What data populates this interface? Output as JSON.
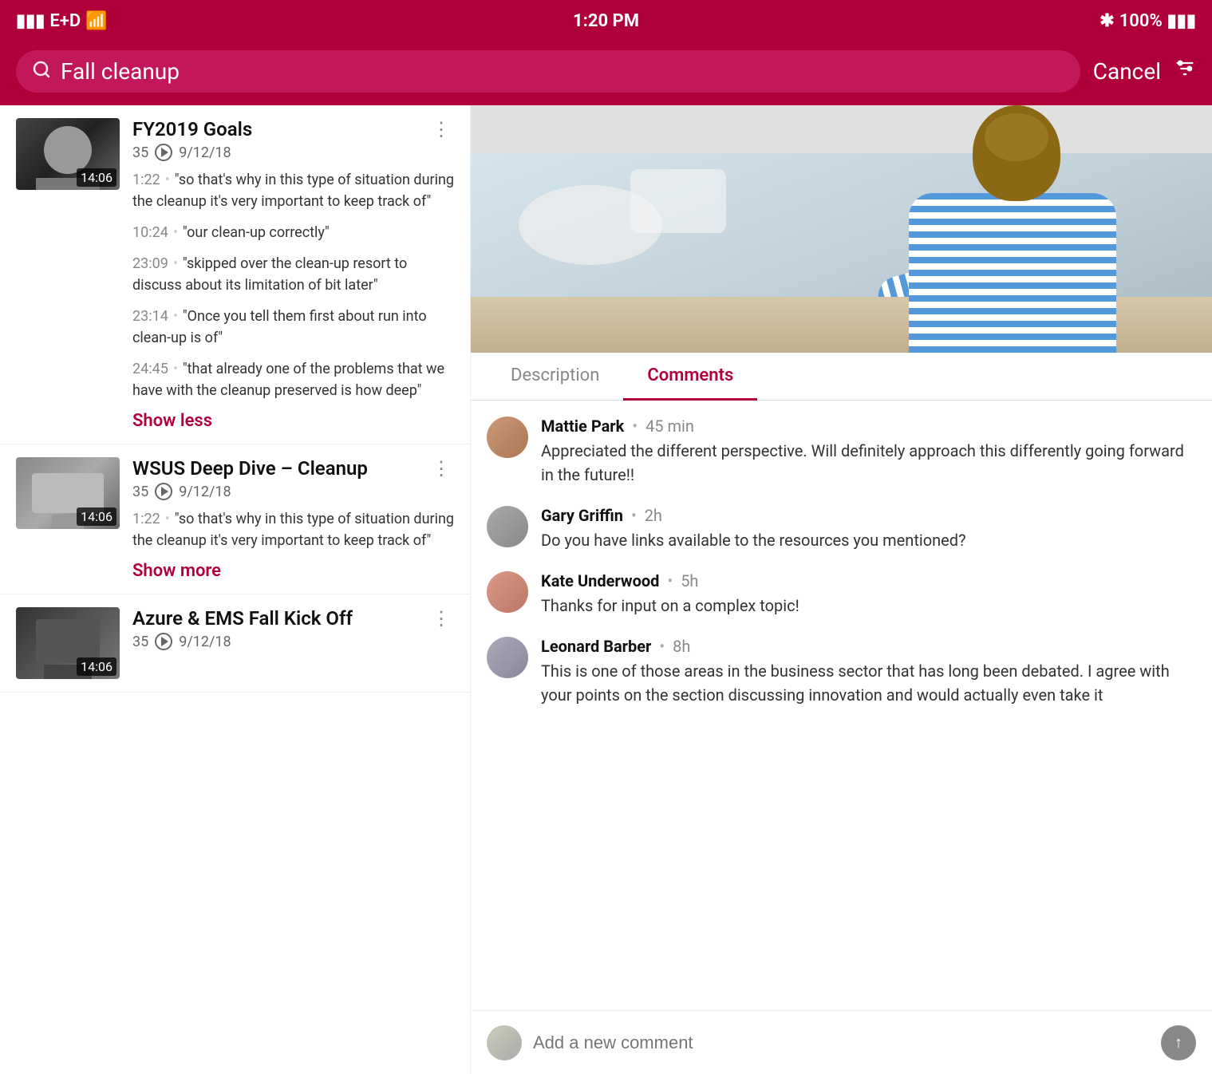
{
  "statusBar": {
    "carrier": "E+D",
    "time": "1:20 PM",
    "battery": "100%"
  },
  "searchBar": {
    "query": "Fall cleanup",
    "cancelLabel": "Cancel"
  },
  "results": [
    {
      "id": 1,
      "title": "FY2019 Goals",
      "count": "35",
      "date": "9/12/18",
      "duration": "14:06",
      "quotes": [
        {
          "time": "1:22",
          "text": "\"so that's why in this type of situation during the cleanup it's very important to keep track of\""
        },
        {
          "time": "10:24",
          "text": "\"our clean-up correctly\""
        },
        {
          "time": "23:09",
          "text": "\"skipped over the clean-up resort to discuss about its limitation of bit later\""
        },
        {
          "time": "23:14",
          "text": "\"Once you tell them first about run into clean-up is of\""
        },
        {
          "time": "24:45",
          "text": "\"that already one of the problems that we have with the cleanup preserved is how deep\""
        }
      ],
      "showToggleLabel": "Show less",
      "showToggleType": "less"
    },
    {
      "id": 2,
      "title": "WSUS Deep Dive - Cleanup",
      "count": "35",
      "date": "9/12/18",
      "duration": "14:06",
      "quotes": [
        {
          "time": "1:22",
          "text": "\"so that's why in this type of situation during the cleanup it's very important to keep track of\""
        }
      ],
      "showToggleLabel": "Show more",
      "showToggleType": "more"
    },
    {
      "id": 3,
      "title": "Azure & EMS Fall Kick Off",
      "count": "35",
      "date": "9/12/18",
      "duration": "14:06",
      "quotes": [],
      "showToggleLabel": "",
      "showToggleType": "none"
    }
  ],
  "rightPanel": {
    "tabs": [
      {
        "id": "description",
        "label": "Description",
        "active": false
      },
      {
        "id": "comments",
        "label": "Comments",
        "active": true
      }
    ],
    "comments": [
      {
        "id": 1,
        "author": "Mattie Park",
        "time": "45 min",
        "text": "Appreciated the different perspective. Will definitely approach this differently going forward in the future!!"
      },
      {
        "id": 2,
        "author": "Gary Griffin",
        "time": "2h",
        "text": "Do you have links available to the resources you mentioned?"
      },
      {
        "id": 3,
        "author": "Kate Underwood",
        "time": "5h",
        "text": "Thanks for input on a complex topic!"
      },
      {
        "id": 4,
        "author": "Leonard Barber",
        "time": "8h",
        "text": "This is one of those areas in the business sector that has long been debated. I agree with your points on the section discussing innovation and would actually even take it"
      }
    ],
    "commentInput": {
      "placeholder": "Add a new comment"
    }
  }
}
